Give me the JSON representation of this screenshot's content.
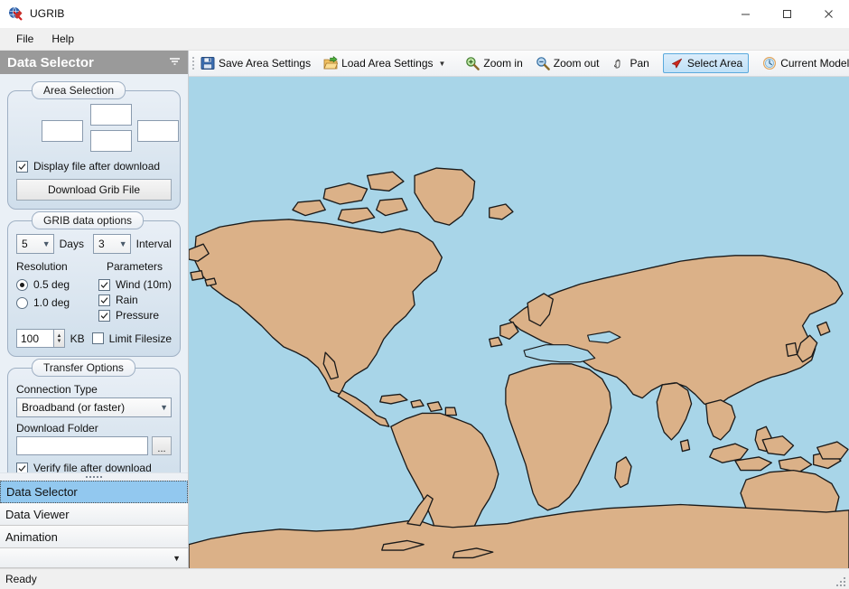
{
  "window": {
    "title": "UGRIB",
    "app_icon": "ugrib-app-icon",
    "minimize_label": "─",
    "maximize_label": "□",
    "close_label": "✕"
  },
  "menubar": {
    "items": [
      {
        "label": "File"
      },
      {
        "label": "Help"
      }
    ]
  },
  "dock": {
    "header_title": "Data Selector",
    "pin_icon": "auto-hide-pin-icon"
  },
  "area_selection": {
    "caption": "Area Selection",
    "north_value": "",
    "west_value": "",
    "east_value": "",
    "south_value": "",
    "display_after_download": {
      "label": "Display file after download",
      "checked": true
    },
    "download_button": "Download Grib File"
  },
  "grib_options": {
    "caption": "GRIB data options",
    "days": {
      "value": "5",
      "label": "Days"
    },
    "interval": {
      "value": "3",
      "label": "Interval"
    },
    "resolution_label": "Resolution",
    "parameters_label": "Parameters",
    "resolution_options": [
      {
        "label": "0.5 deg",
        "selected": true
      },
      {
        "label": "1.0 deg",
        "selected": false
      }
    ],
    "parameters": [
      {
        "label": "Wind (10m)",
        "checked": true
      },
      {
        "label": "Rain",
        "checked": true
      },
      {
        "label": "Pressure",
        "checked": true
      }
    ],
    "filesize_value": "100",
    "filesize_unit": "KB",
    "limit_filesize": {
      "label": "Limit Filesize",
      "checked": false
    }
  },
  "transfer_options": {
    "caption": "Transfer Options",
    "connection_type_label": "Connection Type",
    "connection_type_value": "Broadband (or faster)",
    "download_folder_label": "Download Folder",
    "download_folder_value": "",
    "browse_button": "...",
    "verify_after_download": {
      "label": "Verify file after download",
      "checked": true
    }
  },
  "nav": {
    "items": [
      {
        "label": "Data Selector",
        "selected": true
      },
      {
        "label": "Data Viewer",
        "selected": false
      },
      {
        "label": "Animation",
        "selected": false
      }
    ],
    "more_icon": "chevron-down-icon"
  },
  "toolbar": {
    "items": [
      {
        "label": "Save Area Settings",
        "icon": "save-floppy-icon",
        "active": false,
        "has_caret": false
      },
      {
        "label": "Load Area Settings",
        "icon": "open-folder-icon",
        "active": false,
        "has_caret": true
      },
      {
        "label": "Zoom in",
        "icon": "zoom-in-icon",
        "active": false,
        "has_caret": false
      },
      {
        "label": "Zoom out",
        "icon": "zoom-out-icon",
        "active": false,
        "has_caret": false
      },
      {
        "label": "Pan",
        "icon": "pan-hand-icon",
        "active": false,
        "has_caret": false
      },
      {
        "label": "Select Area",
        "icon": "select-area-arrow-icon",
        "active": true,
        "has_caret": false
      },
      {
        "label": "Current Model Time",
        "icon": "clock-icon",
        "active": false,
        "has_caret": false
      }
    ]
  },
  "map": {
    "ocean_color": "#a8d5e8",
    "land_color": "#dbb188",
    "coast_color": "#1a1a1a"
  },
  "statusbar": {
    "message": "Ready"
  }
}
